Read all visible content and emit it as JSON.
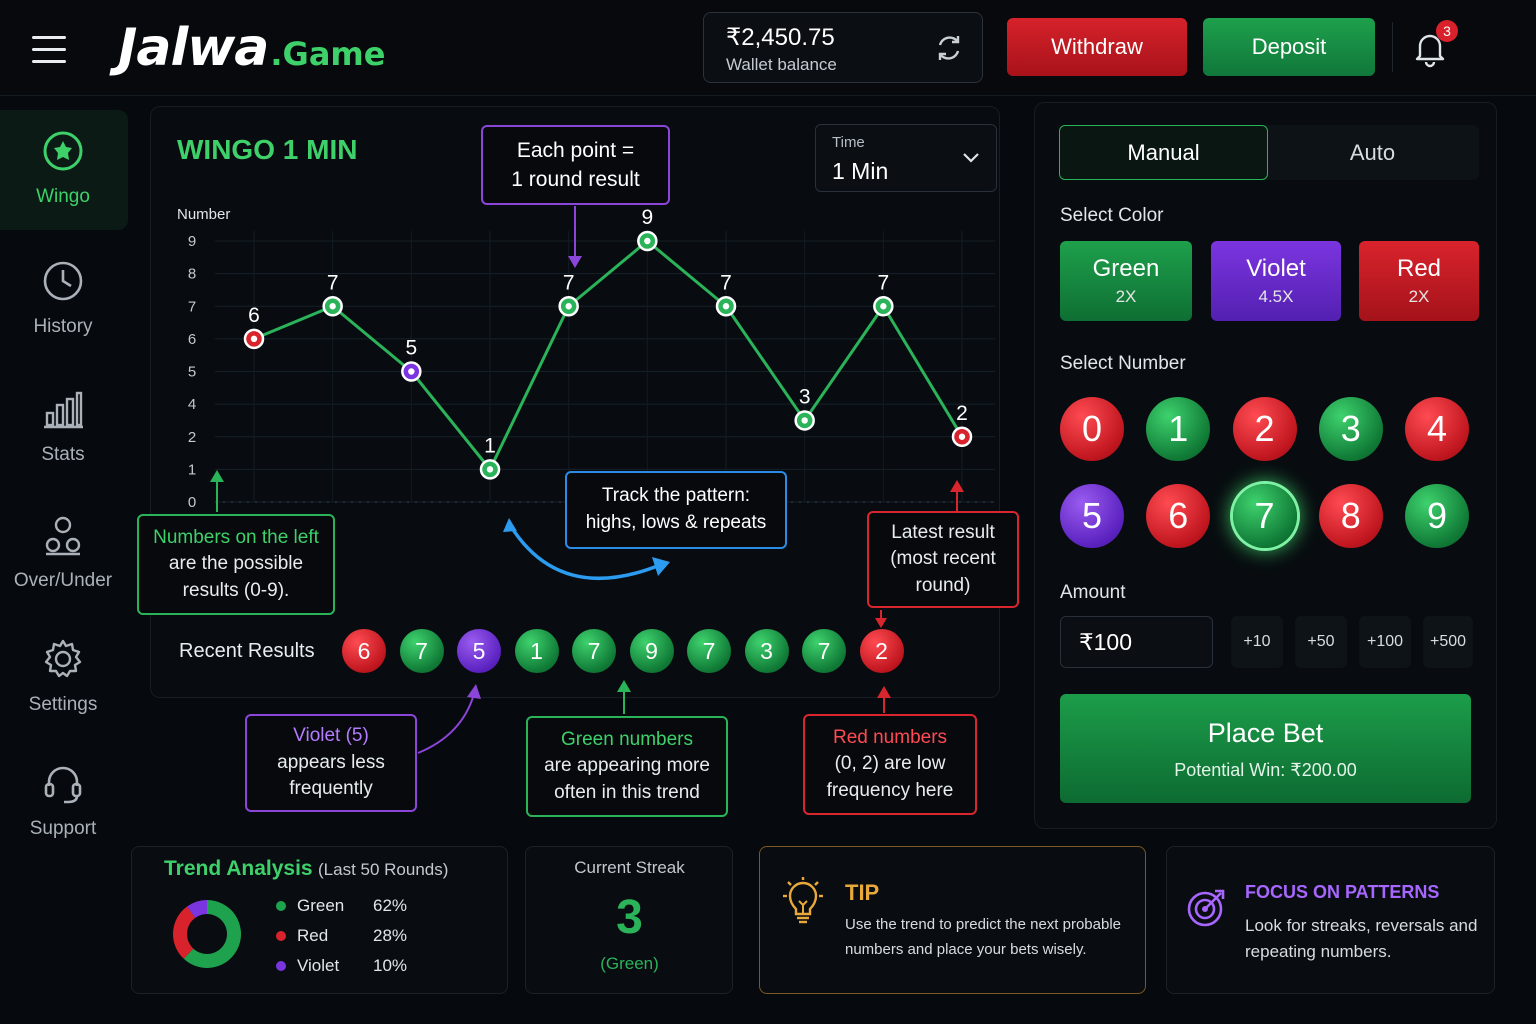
{
  "header": {
    "brand_main": "Jalwa",
    "brand_suffix": ".Game",
    "wallet_amount": "₹2,450.75",
    "wallet_label": "Wallet balance",
    "withdraw_label": "Withdraw",
    "deposit_label": "Deposit",
    "notification_count": "3"
  },
  "sidebar": {
    "items": [
      {
        "label": "Wingo",
        "icon": "wingo-icon",
        "active": true
      },
      {
        "label": "History",
        "icon": "clock-icon"
      },
      {
        "label": "Stats",
        "icon": "bar-chart-icon"
      },
      {
        "label": "Over/Under",
        "icon": "users-icon"
      },
      {
        "label": "Settings",
        "icon": "gear-icon"
      },
      {
        "label": "Support",
        "icon": "headset-icon"
      }
    ]
  },
  "game": {
    "title": "WINGO 1 MIN",
    "time_label": "Time",
    "time_value": "1 Min"
  },
  "chart_data": {
    "type": "line",
    "ylabel": "Number",
    "y_ticks": [
      "0",
      "1",
      "2",
      "4",
      "5",
      "6",
      "7",
      "8",
      "9"
    ],
    "ylim": [
      0,
      9
    ],
    "grid": true,
    "points": [
      {
        "value": 6,
        "color": "red"
      },
      {
        "value": 7,
        "color": "green"
      },
      {
        "value": 5,
        "color": "violet"
      },
      {
        "value": 1,
        "color": "green"
      },
      {
        "value": 7,
        "color": "green"
      },
      {
        "value": 9,
        "color": "green"
      },
      {
        "value": 7,
        "color": "green"
      },
      {
        "value": 3,
        "color": "green"
      },
      {
        "value": 7,
        "color": "green"
      },
      {
        "value": 2,
        "color": "red"
      }
    ],
    "line_color": "#2bb35a"
  },
  "callouts": {
    "each_point_l1": "Each point =",
    "each_point_l2": "1 round result",
    "left_numbers_l1": "Numbers on the left",
    "left_numbers_l2": "are the possible",
    "left_numbers_l3": "results (0-9).",
    "track_l1": "Track the pattern:",
    "track_l2": "highs, lows & repeats",
    "latest_l1": "Latest result",
    "latest_l2": "(most recent",
    "latest_l3": "round)",
    "violet_l1": "Violet (5)",
    "violet_l2": "appears less",
    "violet_l3": "frequently",
    "green_l1": "Green numbers",
    "green_l2": "are appearing more",
    "green_l3": "often in this trend",
    "red_l1": "Red numbers",
    "red_l2": "(0, 2) are low",
    "red_l3": "frequency here"
  },
  "recent": {
    "label": "Recent Results",
    "results": [
      {
        "value": "6",
        "color": "red"
      },
      {
        "value": "7",
        "color": "green"
      },
      {
        "value": "5",
        "color": "violet"
      },
      {
        "value": "1",
        "color": "green"
      },
      {
        "value": "7",
        "color": "green"
      },
      {
        "value": "9",
        "color": "green"
      },
      {
        "value": "7",
        "color": "green"
      },
      {
        "value": "3",
        "color": "green"
      },
      {
        "value": "7",
        "color": "green"
      },
      {
        "value": "2",
        "color": "red"
      }
    ]
  },
  "bet": {
    "tabs": [
      "Manual",
      "Auto"
    ],
    "active_tab": "Manual",
    "select_color_label": "Select Color",
    "colors": [
      {
        "name": "Green",
        "multiplier": "2X"
      },
      {
        "name": "Violet",
        "multiplier": "4.5X"
      },
      {
        "name": "Red",
        "multiplier": "2X"
      }
    ],
    "select_number_label": "Select Number",
    "numbers": [
      {
        "value": "0",
        "color": "red"
      },
      {
        "value": "1",
        "color": "green"
      },
      {
        "value": "2",
        "color": "red"
      },
      {
        "value": "3",
        "color": "green"
      },
      {
        "value": "4",
        "color": "red"
      },
      {
        "value": "5",
        "color": "violet"
      },
      {
        "value": "6",
        "color": "red"
      },
      {
        "value": "7",
        "color": "green"
      },
      {
        "value": "8",
        "color": "red"
      },
      {
        "value": "9",
        "color": "green"
      }
    ],
    "selected_number": "7",
    "amount_label": "Amount",
    "amount_value": "₹100",
    "chips": [
      "+10",
      "+50",
      "+100",
      "+500"
    ],
    "place_bet_label": "Place Bet",
    "potential_win": "Potential Win: ₹200.00"
  },
  "trend": {
    "title": "Trend Analysis",
    "subtitle": "(Last 50 Rounds)",
    "rows": [
      {
        "name": "Green",
        "percent": "62%",
        "color": "#1fa24e",
        "value": 62
      },
      {
        "name": "Red",
        "percent": "28%",
        "color": "#d9232c",
        "value": 28
      },
      {
        "name": "Violet",
        "percent": "10%",
        "color": "#7b35e0",
        "value": 10
      }
    ]
  },
  "streak": {
    "label": "Current Streak",
    "value": "3",
    "sub": "(Green)"
  },
  "tip": {
    "title": "TIP",
    "text": "Use the trend to predict the next probable numbers and place your bets wisely."
  },
  "focus": {
    "title": "FOCUS ON PATTERNS",
    "text": "Look for streaks, reversals and repeating numbers."
  }
}
